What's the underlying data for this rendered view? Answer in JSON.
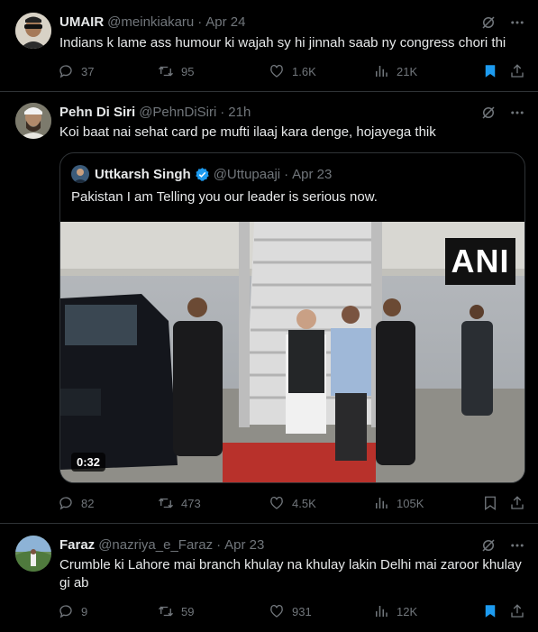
{
  "tweets": [
    {
      "name": "UMAIR",
      "handle": "@meinkiakaru",
      "time": "Apr 24",
      "text": "Indians k lame ass humour ki wajah sy hi jinnah saab ny congress chori thi",
      "replies": "37",
      "retweets": "95",
      "likes": "1.6K",
      "views": "21K"
    },
    {
      "name": "Pehn Di Siri",
      "handle": "@PehnDiSiri",
      "time": "21h",
      "text": "Koi baat nai sehat card pe mufti ilaaj kara denge, hojayega thik",
      "replies": "82",
      "retweets": "473",
      "likes": "4.5K",
      "views": "105K",
      "quote": {
        "name": "Uttkarsh Singh",
        "handle": "@Uttupaaji",
        "time": "Apr 23",
        "text": "Pakistan I am Telling you our leader is serious now.",
        "video_duration": "0:32",
        "watermark": "ANI"
      }
    },
    {
      "name": "Faraz",
      "handle": "@nazriya_e_Faraz",
      "time": "Apr 23",
      "text": "Crumble ki Lahore mai branch khulay na khulay lakin Delhi mai zaroor khulay gi ab",
      "replies": "9",
      "retweets": "59",
      "likes": "931",
      "views": "12K"
    }
  ],
  "separator": "·",
  "colors": {
    "background": "#000000",
    "text": "#e7e9ea",
    "muted": "#71767b",
    "border": "#2f3336",
    "accent": "#1d9bf0"
  },
  "icons": [
    "grok-icon",
    "more-icon",
    "reply-icon",
    "retweet-icon",
    "like-icon",
    "views-icon",
    "bookmark-icon",
    "share-icon",
    "verified-icon"
  ]
}
